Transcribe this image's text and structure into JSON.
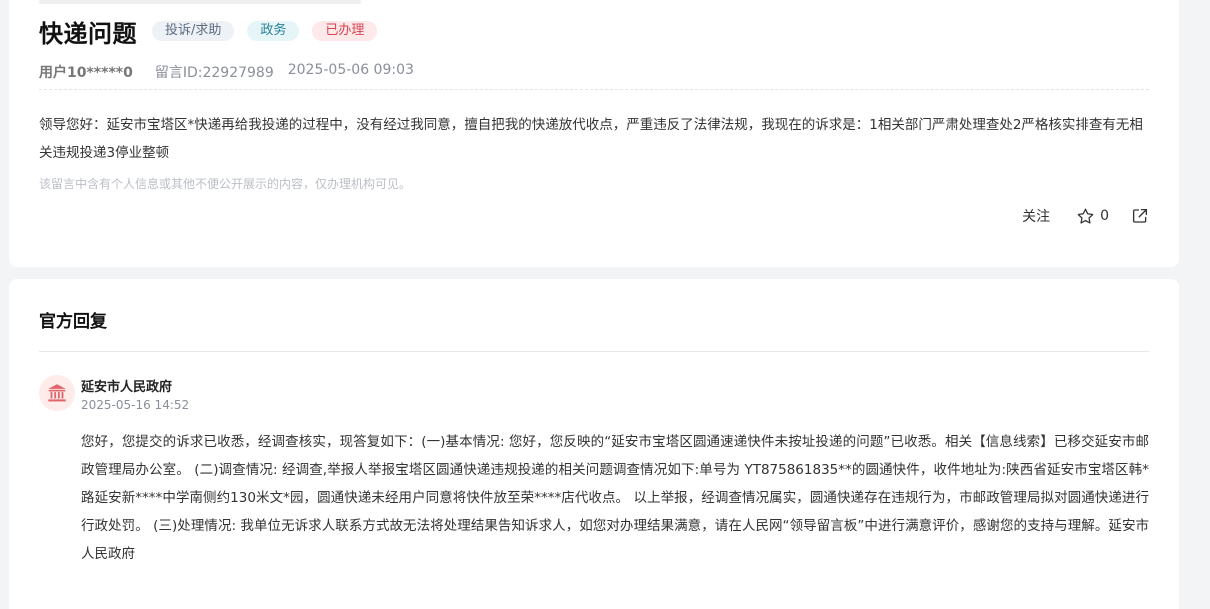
{
  "question": {
    "title": "快递问题",
    "tags": [
      {
        "label": "投诉/求助"
      },
      {
        "label": "政务"
      },
      {
        "label": "已办理"
      }
    ],
    "user": "用户10*****0",
    "message_id": "留言ID:22927989",
    "datetime": "2025-05-06 09:03",
    "body": "领导您好：延安市宝塔区*快递再给我投递的过程中，没有经过我同意，擅自把我的快递放代收点，严重违反了法律法规，我现在的诉求是：1相关部门严肃处理查处2严格核实排查有无相关违规投递3停业整顿",
    "privacy_note": "该留言中含有个人信息或其他不便公开展示的内容，仅办理机构可见。",
    "actions": {
      "follow_label": "关注",
      "star_count": "0",
      "star_icon": "star-icon",
      "share_icon": "share-icon"
    }
  },
  "reply": {
    "heading": "官方回复",
    "org_name": "延安市人民政府",
    "org_icon": "government-building-icon",
    "datetime": "2025-05-16 14:52",
    "body": "您好，您提交的诉求已收悉，经调查核实，现答复如下：(一)基本情况: 您好，您反映的“延安市宝塔区圆通速递快件未按址投递的问题”已收悉。相关【信息线索】已移交延安市邮政管理局办公室。 (二)调查情况: 经调查,举报人举报宝塔区圆通快递违规投递的相关问题调查情况如下:单号为 YT875861835**的圆通快件，收件地址为:陕西省延安市宝塔区韩*路延安新****中学南侧约130米文*园，圆通快递未经用户同意将快件放至荣****店代收点。 以上举报，经调查情况属实，圆通快递存在违规行为，市邮政管理局拟对圆通快递进行行政处罚。 (三)处理情况: 我单位无诉求人联系方式故无法将处理结果告知诉求人，如您对办理结果满意，请在人民网“领导留言板”中进行满意评价，感谢您的支持与理解。延安市人民政府"
  },
  "colors": {
    "page_bg": "#f3f4f6",
    "card_bg": "#ffffff",
    "tag_gray_bg": "#eef1f6",
    "tag_teal_bg": "#e6f6f8",
    "tag_red_bg": "#fde8ea",
    "tag_red_text": "#d94452",
    "org_icon_color": "#e0646a"
  }
}
